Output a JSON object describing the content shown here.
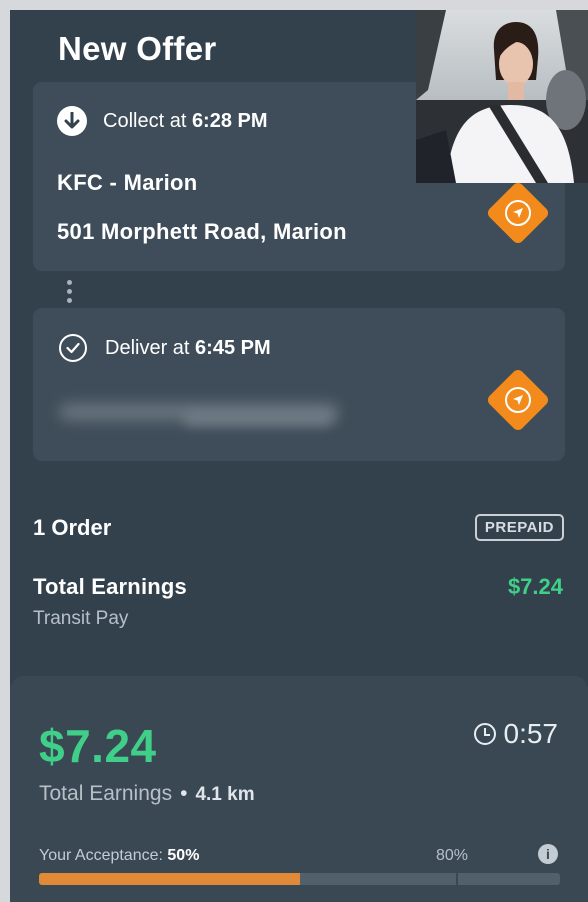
{
  "header": {
    "title": "New Offer"
  },
  "pickup": {
    "collect_prefix": "Collect at",
    "collect_time": "6:28 PM",
    "store_name": "KFC - Marion",
    "address": "501 Morphett Road, Marion"
  },
  "dropoff": {
    "deliver_prefix": "Deliver at",
    "deliver_time": "6:45 PM"
  },
  "order": {
    "count_label": "1 Order",
    "payment_badge": "PREPAID",
    "earnings_label": "Total Earnings",
    "earnings_value": "$7.24",
    "pay_type": "Transit Pay"
  },
  "summary": {
    "amount": "$7.24",
    "timer": "0:57",
    "earnings_label": "Total Earnings",
    "separator": "•",
    "distance": "4.1 km",
    "acceptance_label": "Your Acceptance:",
    "acceptance_value": "50%",
    "acceptance_fraction": 0.5,
    "target_label": "80%",
    "target_fraction": 0.8
  },
  "colors": {
    "accent_green": "#3fcf88",
    "nav_orange": "#f28a1c",
    "progress_orange": "#e08a37",
    "background": "#33414d"
  },
  "icons": {
    "collect": "arrow-down-circle-icon",
    "deliver": "check-circle-icon",
    "navigate": "navigation-icon",
    "timer": "clock-icon",
    "info": "info-icon"
  }
}
